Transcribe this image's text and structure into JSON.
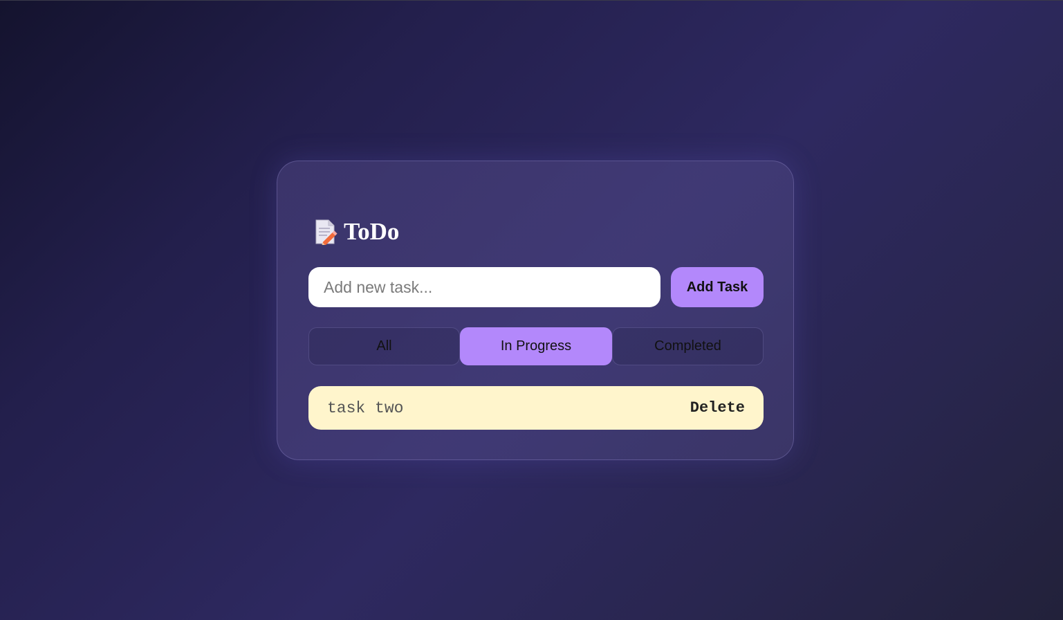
{
  "app": {
    "title": "ToDo",
    "title_icon": "memo-icon"
  },
  "new_task": {
    "placeholder": "Add new task...",
    "value": "",
    "add_button_label": "Add Task"
  },
  "filters": {
    "items": [
      {
        "label": "All",
        "active": false
      },
      {
        "label": "In Progress",
        "active": true
      },
      {
        "label": "Completed",
        "active": false
      }
    ]
  },
  "tasks": [
    {
      "text": "task two",
      "delete_label": "Delete"
    }
  ],
  "colors": {
    "accent": "#b388fb",
    "task_background": "#fff5cc",
    "input_background": "#ffffff"
  }
}
